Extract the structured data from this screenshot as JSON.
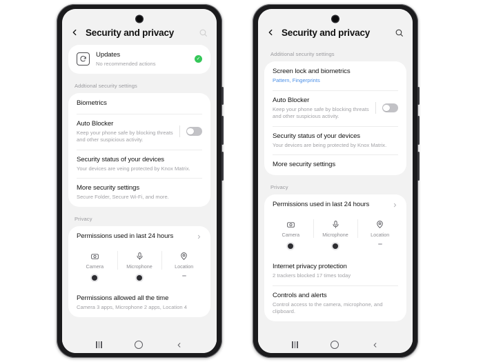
{
  "page": {
    "background": "#ffffff",
    "accent_blue": "#4a8fe7",
    "status_green": "#35c759"
  },
  "phones": [
    {
      "id": "phone-left",
      "appbar": {
        "back_label": "back-chevron",
        "title": "Security and privacy",
        "search_label": "search-icon"
      },
      "updates_card": {
        "title": "Updates",
        "subtitle": "No recommended actions",
        "icon": "update-icon",
        "badge": "✓"
      },
      "section_label": "Addtional security settings",
      "rows": [
        {
          "title": "Biometrics",
          "subtitle": "",
          "control": "none"
        },
        {
          "title": "Auto Blocker",
          "subtitle": "Keep your phone safe by blocking threats and other suspicious activity.",
          "control": "toggle",
          "toggle_on": false
        },
        {
          "title": "Security status of your devices",
          "subtitle": "Your devices are veing protected by Knox Matrix.",
          "control": "none"
        },
        {
          "title": "More security settings",
          "subtitle": "Secure Folder, Secure Wi-Fi, and more.",
          "control": "none"
        }
      ],
      "privacy_label": "Privacy",
      "privacy_header": {
        "title": "Permissions used in last 24 hours",
        "chevron": "chevron-right"
      },
      "permissions": [
        {
          "name": "Camera",
          "icon": "camera-icon",
          "state": "active"
        },
        {
          "name": "Microphone",
          "icon": "microphone-icon",
          "state": "active"
        },
        {
          "name": "Location",
          "icon": "location-pin-icon",
          "state": "inactive"
        }
      ],
      "privacy_rows": [
        {
          "title": "Permissions allowed all the time",
          "subtitle": "Camera 3 apps, Microphone 2 apps, Location 4"
        }
      ],
      "navbar": {
        "recents": "recents-icon",
        "home": "home-icon",
        "back": "back-icon"
      }
    },
    {
      "id": "phone-right",
      "appbar": {
        "back_label": "back-chevron",
        "title": "Security and privacy",
        "search_label": "search-icon"
      },
      "section_label": "Additional security settings",
      "rows": [
        {
          "title": "Screen lock and biometrics",
          "subtitle": "Pattern, Fingerprints",
          "subtitle_accent": true,
          "control": "none"
        },
        {
          "title": "Auto Blocker",
          "subtitle": "Keep your phone safe by blocking threats and other suspicious activity.",
          "control": "toggle",
          "toggle_on": false
        },
        {
          "title": "Security status of your devices",
          "subtitle": "Your devices are being protected by Knox Matrix.",
          "control": "none"
        },
        {
          "title": "More security settings",
          "subtitle": "",
          "control": "none"
        }
      ],
      "privacy_label": "Privacy",
      "privacy_header": {
        "title": "Permissions used in last 24 hours",
        "chevron": "chevron-right"
      },
      "permissions": [
        {
          "name": "Camera",
          "icon": "camera-icon",
          "state": "active"
        },
        {
          "name": "Microphone",
          "icon": "microphone-icon",
          "state": "active"
        },
        {
          "name": "Location",
          "icon": "location-pin-icon",
          "state": "inactive"
        }
      ],
      "privacy_rows": [
        {
          "title": "Internet privacy protection",
          "subtitle": "2 trackers blocked 17 times today"
        },
        {
          "title": "Controls and alerts",
          "subtitle": "Control access to the camera, microphone, and clipboard."
        }
      ],
      "navbar": {
        "recents": "recents-icon",
        "home": "home-icon",
        "back": "back-icon"
      }
    }
  ]
}
